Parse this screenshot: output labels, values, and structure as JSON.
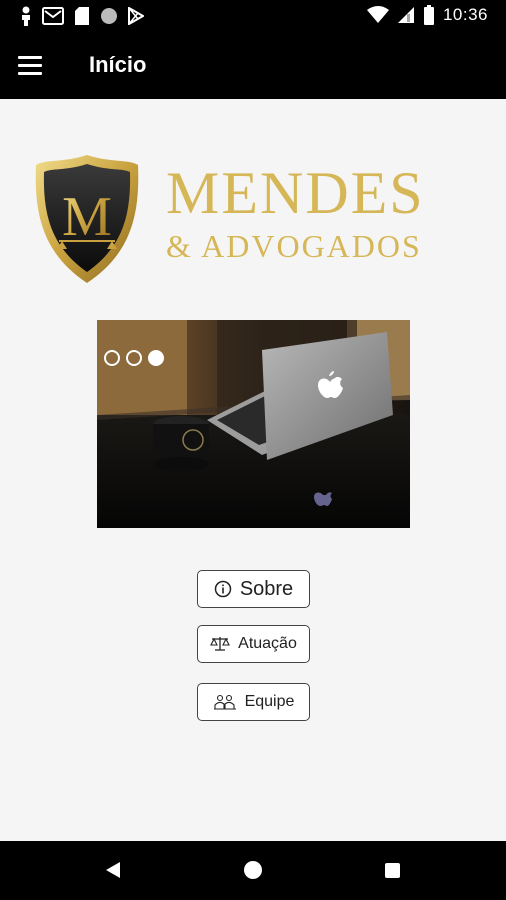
{
  "status_bar": {
    "time": "10:36",
    "left_icons": [
      "person-pin-icon",
      "gmail-icon",
      "sim-card-icon",
      "circle-icon",
      "play-store-icon"
    ],
    "right_icons": [
      "wifi-icon",
      "signal-icon",
      "battery-icon"
    ]
  },
  "app_bar": {
    "title": "Início",
    "menu_icon": "menu-icon"
  },
  "logo": {
    "monogram": "M",
    "name": "MENDES",
    "subtitle": "& ADVOGADOS",
    "gold": "#d6b757"
  },
  "carousel": {
    "slide_count": 3,
    "active_index": 2
  },
  "nav_buttons": {
    "sobre": {
      "label": "Sobre",
      "icon": "info-icon"
    },
    "atuacao": {
      "label": "Atuação",
      "icon": "scales-icon"
    },
    "equipe": {
      "label": "Equipe",
      "icon": "team-icon"
    }
  },
  "system_nav": {
    "icons": [
      "back-icon",
      "home-icon",
      "recents-icon"
    ]
  }
}
